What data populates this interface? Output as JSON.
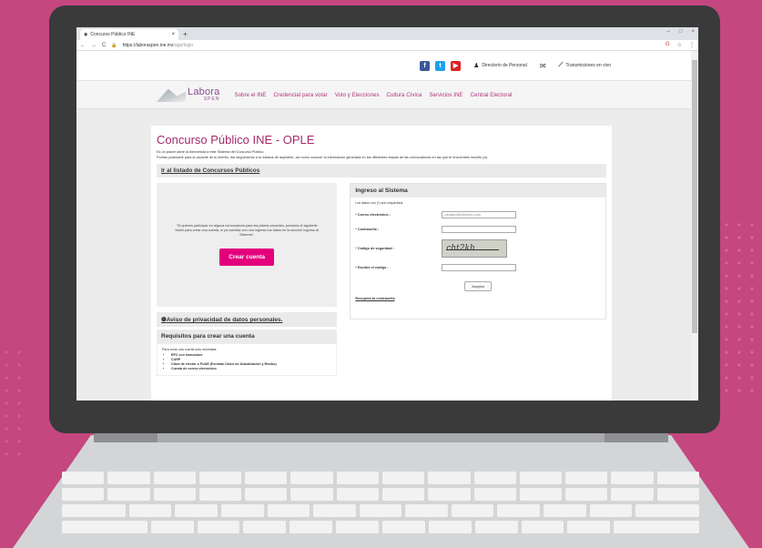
{
  "browser": {
    "tab_title": "Concurso Público INE",
    "tab_close": "×",
    "new_tab": "+",
    "url_host": "https://laboraspen.ine.mx",
    "url_path": "/app/login",
    "nav_back": "←",
    "nav_forward": "→",
    "nav_reload": "C",
    "lock": "🔒",
    "window_controls": [
      "–",
      "□",
      "×"
    ],
    "ext_icons": [
      "G",
      "☆",
      "⋮"
    ]
  },
  "topbar": {
    "social": [
      "f",
      "t",
      "▶"
    ],
    "directory_label": "Directorio de Personal",
    "live_label": "Transmisiones en vivo"
  },
  "logo": {
    "line1": "Labora",
    "line2": "SPEN"
  },
  "nav": {
    "items": [
      "Sobre el INE",
      "Credencial para votar",
      "Voto y Elecciones",
      "Cultura Cívica",
      "Servicios INE",
      "Central Electoral"
    ]
  },
  "main": {
    "title": "Concurso Público INE - OPLE",
    "intro_1": "Es un placer darte la bienvenida a este Sistema del Concurso Público.",
    "intro_2": "Podrás postularte para la vacante de tu interés, dar seguimiento a tu estatus de aspirante, así como conocer la información generada en las diferentes etapas de las convocatorias en las que te encuentres inscrito (a).",
    "listing_link": "Ir al listado de Concursos Públicos",
    "create_text": "\"Si quieres participar en alguna convocatoria para las plazas vacantes, presiona el siguiente botón para crear una cuenta, si ya cuentas con una ingresa tus datos en la sección Ingreso al Sistema\".",
    "create_button": "Crear cuenta",
    "privacy_link": "Aviso de privacidad de datos personales.",
    "privacy_icon": "❶",
    "requirements_title": "Requisitos para crear una cuenta",
    "requirements_intro": "Para crear una cuenta solo necesitas:",
    "requirements": [
      "RFC con homoclave",
      "CURP",
      "Clave de elector o FUAR (Formato Único de Actualización y Recibo)",
      "Cuenta de correo electrónico"
    ]
  },
  "login": {
    "title": "Ingreso al Sistema",
    "required_note_pre": "Los datos con (",
    "required_star": "*",
    "required_note_post": ") son requeridos.",
    "email_label": "* Correo electrónico :",
    "email_placeholder": "usuario@dominio.com",
    "password_label": "* Contraseña :",
    "security_label": "* Código de seguridad :",
    "captcha_text": "cht2kh",
    "code_label": "* Escribe el código :",
    "accept_button": "Aceptar",
    "recover_link": "Recupera tu contraseña"
  }
}
